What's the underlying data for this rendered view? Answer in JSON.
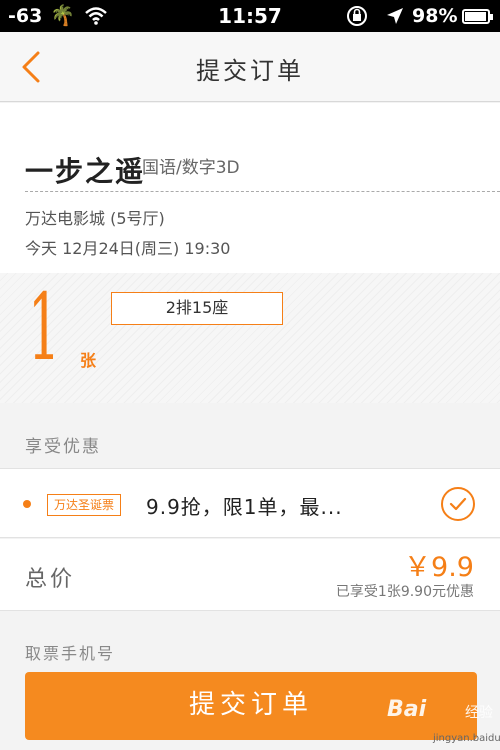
{
  "status_bar": {
    "signal": "-63",
    "time": "11:57",
    "battery": "98%"
  },
  "nav": {
    "title": "提交订单",
    "back_icon": "chevron-left-icon"
  },
  "movie": {
    "title": "一步之遥",
    "meta": "国语/数字3D",
    "cinema": "万达电影城 (5号厅)",
    "showtime": "今天 12月24日(周三) 19:30"
  },
  "tickets": {
    "count": "1",
    "unit": "张",
    "seats": [
      "2排15座"
    ]
  },
  "discount": {
    "section_label": "享受优惠",
    "badge": "万达圣诞票",
    "description": "9.9抢，限1单，最...",
    "selected": true
  },
  "total": {
    "label": "总价",
    "price": "￥9.9",
    "saved_text": "已享受1张9.90元优惠"
  },
  "phone": {
    "label": "取票手机号"
  },
  "submit": {
    "label": "提交订单"
  },
  "watermark": {
    "brand": "Bai",
    "brand_suffix": "经验",
    "url": "jingyan.baidu.com"
  },
  "colors": {
    "accent": "#f57f17",
    "button": "#f58a1f",
    "status_bar": "#000000",
    "background": "#f3f3f3"
  }
}
